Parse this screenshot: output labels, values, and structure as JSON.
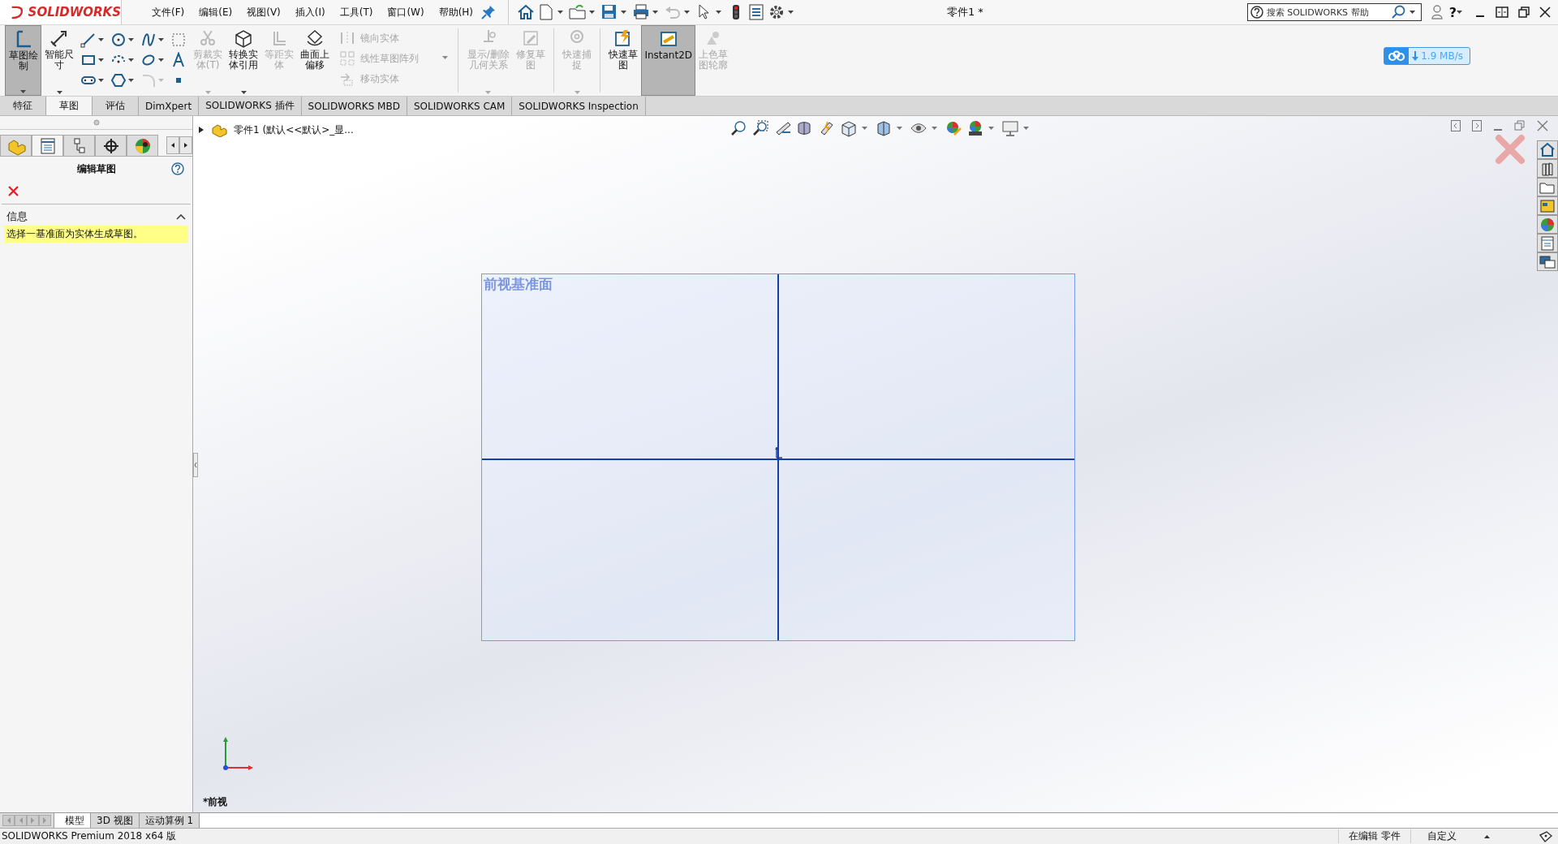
{
  "app": {
    "logo_text": "SOLIDWORKS",
    "title": "零件1 *"
  },
  "menu": [
    {
      "label": "文件(F)"
    },
    {
      "label": "编辑(E)"
    },
    {
      "label": "视图(V)"
    },
    {
      "label": "插入(I)"
    },
    {
      "label": "工具(T)"
    },
    {
      "label": "窗口(W)"
    },
    {
      "label": "帮助(H)"
    }
  ],
  "search": {
    "placeholder": "搜索 SOLIDWORKS 帮助"
  },
  "help_glyph": "?",
  "download_badge": {
    "speed": "1.9 MB/s"
  },
  "ribbon": [
    {
      "kind": "large",
      "label": "草图绘制",
      "selected": true,
      "disabled": false,
      "dropdown": true
    },
    {
      "kind": "large",
      "label": "智能尺寸",
      "selected": false,
      "disabled": false,
      "dropdown": true
    },
    {
      "kind": "grid"
    },
    {
      "kind": "large",
      "label": "剪裁实体(T)",
      "selected": false,
      "disabled": true,
      "dropdown": true
    },
    {
      "kind": "large",
      "label": "转换实体引用",
      "selected": false,
      "disabled": false,
      "dropdown": true
    },
    {
      "kind": "large",
      "label": "等距实体",
      "selected": false,
      "disabled": true,
      "dropdown": false
    },
    {
      "kind": "large",
      "label": "曲面上偏移",
      "selected": false,
      "disabled": false,
      "dropdown": false
    },
    {
      "kind": "list",
      "items": [
        {
          "label": "镜向实体",
          "disabled": true
        },
        {
          "label": "线性草图阵列",
          "disabled": true
        },
        {
          "label": "移动实体",
          "disabled": true
        }
      ]
    },
    {
      "kind": "separator"
    },
    {
      "kind": "large",
      "label": "显示/删除几何关系",
      "selected": false,
      "disabled": true,
      "dropdown": true
    },
    {
      "kind": "large",
      "label": "修复草图",
      "selected": false,
      "disabled": true,
      "dropdown": false
    },
    {
      "kind": "separator"
    },
    {
      "kind": "large",
      "label": "快速捕捉",
      "selected": false,
      "disabled": true,
      "dropdown": true
    },
    {
      "kind": "separator"
    },
    {
      "kind": "large",
      "label": "快速草图",
      "selected": false,
      "disabled": false,
      "dropdown": false
    },
    {
      "kind": "large",
      "label": "Instant2D",
      "selected": true,
      "disabled": false,
      "dropdown": false
    },
    {
      "kind": "large",
      "label": "上色草图轮廓",
      "selected": false,
      "disabled": true,
      "dropdown": false
    }
  ],
  "tabs": [
    {
      "label": "特征",
      "selected": false
    },
    {
      "label": "草图",
      "selected": true
    },
    {
      "label": "评估",
      "selected": false
    },
    {
      "label": "DimXpert",
      "selected": false
    },
    {
      "label": "SOLIDWORKS 插件",
      "selected": false
    },
    {
      "label": "SOLIDWORKS MBD",
      "selected": false
    },
    {
      "label": "SOLIDWORKS CAM",
      "selected": false
    },
    {
      "label": "SOLIDWORKS Inspection",
      "selected": false
    }
  ],
  "property_manager": {
    "panel_tabs": [
      {
        "selected": false
      },
      {
        "selected": true
      },
      {
        "selected": false
      },
      {
        "selected": false
      },
      {
        "selected": false
      }
    ],
    "title": "编辑草图",
    "section": {
      "label": "信息",
      "expanded": true,
      "message": "选择一基准面为实体生成草图。"
    }
  },
  "tree": {
    "label": "零件1  (默认<<默认>_显...",
    "expanded": false
  },
  "viewport": {
    "plane_label": "前视基准面",
    "view_name": "*前视"
  },
  "bottom_tabs": [
    {
      "label": "模型",
      "selected": true
    },
    {
      "label": "3D 视图",
      "selected": false
    },
    {
      "label": "运动算例 1",
      "selected": false
    }
  ],
  "status_bar": {
    "product": "SOLIDWORKS Premium 2018 x64 版",
    "mode": "在编辑 零件",
    "units": "自定义"
  }
}
